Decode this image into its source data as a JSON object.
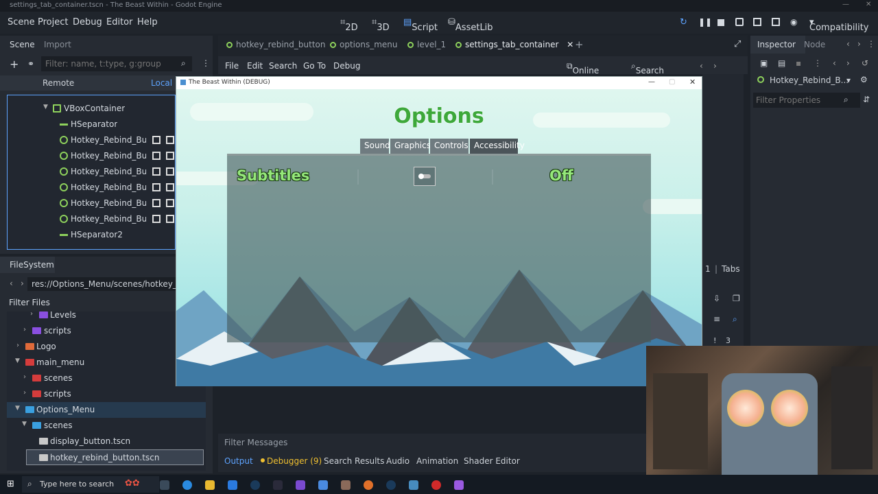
{
  "window_title": "settings_tab_container.tscn - The Beast Within - Godot Engine",
  "menu": [
    "Scene",
    "Project",
    "Debug",
    "Editor",
    "Help"
  ],
  "workspaces": {
    "w2d": "2D",
    "w3d": "3D",
    "script": "Script",
    "assetlib": "AssetLib"
  },
  "renderer": "Compatibility",
  "scene_dock": {
    "tabs": [
      "Scene",
      "Import"
    ],
    "filter_placeholder": "Filter: name, t:type, g:group",
    "remote_label": "Remote",
    "local_label": "Local",
    "tree": [
      {
        "label": "VBoxContainer"
      },
      {
        "label": "HSeparator"
      },
      {
        "label": "Hotkey_Rebind_Bu..."
      },
      {
        "label": "Hotkey_Rebind_Bu..."
      },
      {
        "label": "Hotkey_Rebind_Bu..."
      },
      {
        "label": "Hotkey_Rebind_Bu..."
      },
      {
        "label": "Hotkey_Rebind_Bu..."
      },
      {
        "label": "Hotkey_Rebind_Bu..."
      },
      {
        "label": "HSeparator2"
      }
    ]
  },
  "filesystem_dock": {
    "title": "FileSystem",
    "path": "res://Options_Menu/scenes/hotkey_reb",
    "filter_label": "Filter Files",
    "items": [
      {
        "label": "Levels",
        "color": "#8a4fe0"
      },
      {
        "label": "scripts",
        "color": "#8a4fe0"
      },
      {
        "label": "Logo",
        "color": "#e06a3a"
      },
      {
        "label": "main_menu",
        "color": "#d43c3c"
      },
      {
        "label": "scenes",
        "color": "#d43c3c"
      },
      {
        "label": "scripts",
        "color": "#d43c3c"
      },
      {
        "label": "Options_Menu",
        "color": "#3aa0e0"
      },
      {
        "label": "scenes",
        "color": "#3aa0e0"
      },
      {
        "label": "display_button.tscn",
        "color": "#c8c8c8"
      },
      {
        "label": "hotkey_rebind_button.tscn",
        "color": "#c8c8c8"
      }
    ]
  },
  "editor_tabs": [
    "hotkey_rebind_button",
    "options_menu",
    "level_1",
    "settings_tab_container"
  ],
  "script_menu": [
    "File",
    "Edit",
    "Search",
    "Go To",
    "Debug"
  ],
  "script_help": {
    "online_docs": "Online Docs",
    "search_help": "Search Help"
  },
  "inspector": {
    "tabs": [
      "Inspector",
      "Node"
    ],
    "object": "Hotkey_Rebind_B...",
    "filter_placeholder": "Filter Properties"
  },
  "code_side": {
    "line": "1",
    "tabs_label": "Tabs",
    "warnings": "3"
  },
  "game_window": {
    "title": "The Beast Within (DEBUG)",
    "heading": "Options",
    "tabs": [
      "Sound",
      "Graphics",
      "Controls",
      "Accessibility"
    ],
    "selected_tab": "Accessibility",
    "row_label": "Subtitles",
    "row_value": "Off"
  },
  "bottom_panel": {
    "filter_messages": "Filter Messages",
    "tabs": [
      "Output",
      "Debugger (9)",
      "Search Results",
      "Audio",
      "Animation",
      "Shader Editor"
    ]
  },
  "taskbar": {
    "search_placeholder": "Type here to search"
  },
  "colors": {
    "accent": "#5ea4ff",
    "node_green": "#8ed15c",
    "options_green": "#95e87a"
  }
}
